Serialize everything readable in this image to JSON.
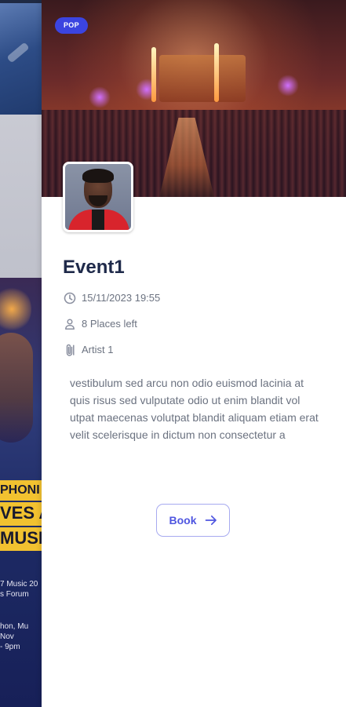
{
  "event": {
    "genre_badge": "POP",
    "title": "Event1",
    "datetime": "15/11/2023 19:55",
    "places_left": "8 Places left",
    "artist": "Artist 1",
    "description": "vestibulum sed arcu non odio euismod lacinia at quis risus sed vulputate odio ut enim blandit vol utpat maecenas volutpat blandit aliquam etiam erat velit scelerisque in dictum non consectetur a",
    "book_label": "Book"
  },
  "background_poster": {
    "line1": "PHONI",
    "line2": "VES A",
    "line3": "MUSI",
    "small1": "7 Music 20",
    "small2": "s Forum",
    "small3": "hon, Mu",
    "small4": "Nov",
    "small5": "- 9pm"
  },
  "icons": {
    "date": "clock-icon",
    "places": "person-icon",
    "artist": "paperclip-icon",
    "book": "arrow-right-icon"
  },
  "colors": {
    "accent": "#4f56e0",
    "badge": "#3b44e0",
    "title": "#1f2a4a",
    "muted_text": "#6b7280"
  }
}
